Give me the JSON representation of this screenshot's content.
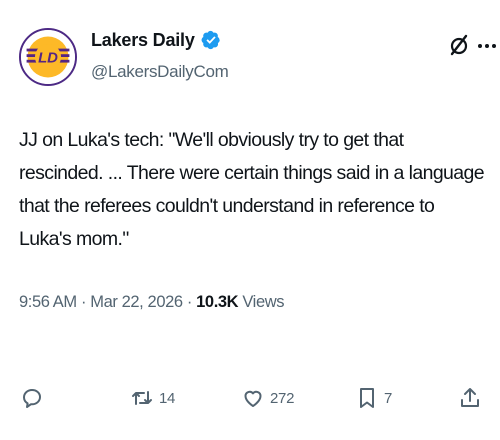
{
  "author": {
    "display_name": "Lakers Daily",
    "handle": "@LakersDailyCom",
    "verified": true,
    "avatar_icon": "lakers-daily-logo",
    "avatar_text": "LD"
  },
  "header_icons": {
    "grok": "grok-icon",
    "more": "more-icon"
  },
  "tweet": {
    "text": "JJ on Luka's tech: \"We'll obviously try to get that rescinded. ... There were certain things said in a language that the referees couldn't understand in reference to Luka's mom.\"",
    "time": "9:56 AM",
    "separator": "·",
    "date": "Mar 22, 2026",
    "views_count": "10.3K",
    "views_label": "Views"
  },
  "actions": {
    "reply_count": "",
    "retweet_count": "14",
    "like_count": "272",
    "bookmark_count": "7"
  },
  "colors": {
    "text_primary": "#0f1419",
    "text_secondary": "#536471",
    "verified_blue": "#1d9bf0",
    "lakers_purple": "#552583",
    "lakers_gold": "#fdb927"
  }
}
